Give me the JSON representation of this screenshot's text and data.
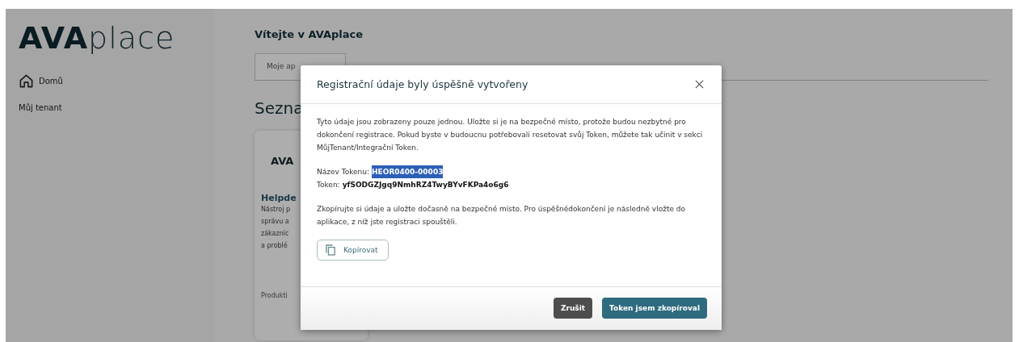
{
  "sidebar": {
    "logo": {
      "bold": "AVA",
      "light": "place"
    },
    "items": [
      {
        "label": "Domů"
      },
      {
        "label": "Můj tenant"
      }
    ]
  },
  "main": {
    "title": "Vítejte v AVAplace",
    "tabs": [
      {
        "label": "Moje ap",
        "selected": true
      }
    ],
    "heading": "Sezna",
    "card": {
      "logo": "AVA",
      "title": "Helpde",
      "description": [
        "Nástroj p",
        "správu a",
        "zákazníc",
        "a problé"
      ],
      "footer": "Produkti"
    }
  },
  "dialog": {
    "title": "Registrační údaje byly úspěšně vytvořeny",
    "intro": "Tyto údaje jsou zobrazeny pouze jednou. Uložte si je na bezpečné místo, protože budou nezbytné pro dokončení registrace. Pokud byste v budoucnu potřebovali resetovat svůj Token, můžete tak učinit v sekci MůjTenant/Integrační Token.",
    "fields": [
      {
        "label": "Název Tokenu:",
        "value": "HEOR0400-00003",
        "selected": true
      },
      {
        "label": "Token:",
        "value": "yfSODGZJgq9NmhRZ4TwyBYvFKPa4o6g6",
        "selected": false
      }
    ],
    "note": "Zkopírujte si údaje a uložte dočasně na bezpečné místo. Pro úspěšnédokončení je následně vložte do aplikace, z níž jste registraci spouštěli.",
    "copy_button": "Kopírovat",
    "buttons": [
      {
        "label": "Zrušit",
        "kind": "secondary"
      },
      {
        "label": "Token jsem zkopíroval",
        "kind": "primary"
      }
    ]
  }
}
